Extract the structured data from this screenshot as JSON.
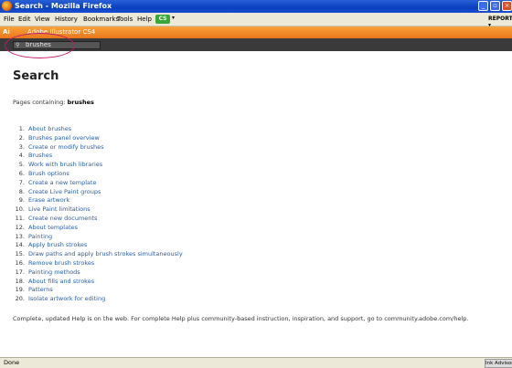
{
  "window": {
    "title": "Search - Mozilla Firefox",
    "minimize": "_",
    "restore": "▫",
    "close": "×"
  },
  "menubar": {
    "items": [
      "File",
      "Edit",
      "View",
      "History",
      "Bookmarks",
      "Tools",
      "Help"
    ],
    "report": "REPORT ▾"
  },
  "app_header": {
    "badge": "Ai",
    "name": "Adobe Illustrator CS4"
  },
  "search": {
    "value": "brushes"
  },
  "page": {
    "heading": "Search",
    "pages_containing_label": "Pages containing:",
    "query": "brushes",
    "results": [
      "About brushes",
      "Brushes panel overview",
      "Create or modify brushes",
      "Brushes",
      "Work with brush libraries",
      "Brush options",
      "Create a new template",
      "Create Live Paint groups",
      "Erase artwork",
      "Live Paint limitations",
      "Create new documents",
      "About templates",
      "Painting",
      "Apply brush strokes",
      "Draw paths and apply brush strokes simultaneously",
      "Remove brush strokes",
      "Painting methods",
      "About fills and strokes",
      "Patterns",
      "Isolate artwork for editing"
    ],
    "footer": "Complete, updated Help is on the web. For complete Help plus community-based instruction, inspiration, and support, go to community.adobe.com/help."
  },
  "status": {
    "left": "Done",
    "right": "Ink Advisor"
  }
}
